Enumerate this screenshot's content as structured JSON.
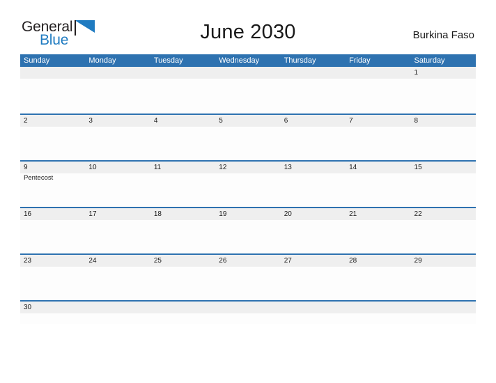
{
  "logo": {
    "word1": "General",
    "word2": "Blue",
    "flag_icon": "blue-triangle-flag-icon",
    "colors": {
      "general": "#231f20",
      "blue": "#1f7bc1",
      "flag": "#1f7bc1"
    }
  },
  "header": {
    "title": "June 2030",
    "country": "Burkina Faso"
  },
  "colors": {
    "header_blue": "#2e72b0",
    "row_divider_blue": "#2e72b0",
    "day_band_gray": "#efefef",
    "cell_background": "#fdfdfd",
    "text": "#1a1a1a",
    "weekday_text": "#ffffff"
  },
  "calendar": {
    "weekdays": [
      "Sunday",
      "Monday",
      "Tuesday",
      "Wednesday",
      "Thursday",
      "Friday",
      "Saturday"
    ],
    "weeks": [
      [
        {
          "day": "",
          "event": ""
        },
        {
          "day": "",
          "event": ""
        },
        {
          "day": "",
          "event": ""
        },
        {
          "day": "",
          "event": ""
        },
        {
          "day": "",
          "event": ""
        },
        {
          "day": "",
          "event": ""
        },
        {
          "day": "1",
          "event": ""
        }
      ],
      [
        {
          "day": "2",
          "event": ""
        },
        {
          "day": "3",
          "event": ""
        },
        {
          "day": "4",
          "event": ""
        },
        {
          "day": "5",
          "event": ""
        },
        {
          "day": "6",
          "event": ""
        },
        {
          "day": "7",
          "event": ""
        },
        {
          "day": "8",
          "event": ""
        }
      ],
      [
        {
          "day": "9",
          "event": "Pentecost"
        },
        {
          "day": "10",
          "event": ""
        },
        {
          "day": "11",
          "event": ""
        },
        {
          "day": "12",
          "event": ""
        },
        {
          "day": "13",
          "event": ""
        },
        {
          "day": "14",
          "event": ""
        },
        {
          "day": "15",
          "event": ""
        }
      ],
      [
        {
          "day": "16",
          "event": ""
        },
        {
          "day": "17",
          "event": ""
        },
        {
          "day": "18",
          "event": ""
        },
        {
          "day": "19",
          "event": ""
        },
        {
          "day": "20",
          "event": ""
        },
        {
          "day": "21",
          "event": ""
        },
        {
          "day": "22",
          "event": ""
        }
      ],
      [
        {
          "day": "23",
          "event": ""
        },
        {
          "day": "24",
          "event": ""
        },
        {
          "day": "25",
          "event": ""
        },
        {
          "day": "26",
          "event": ""
        },
        {
          "day": "27",
          "event": ""
        },
        {
          "day": "28",
          "event": ""
        },
        {
          "day": "29",
          "event": ""
        }
      ],
      [
        {
          "day": "30",
          "event": ""
        },
        {
          "day": "",
          "event": ""
        },
        {
          "day": "",
          "event": ""
        },
        {
          "day": "",
          "event": ""
        },
        {
          "day": "",
          "event": ""
        },
        {
          "day": "",
          "event": ""
        },
        {
          "day": "",
          "event": ""
        }
      ]
    ]
  }
}
